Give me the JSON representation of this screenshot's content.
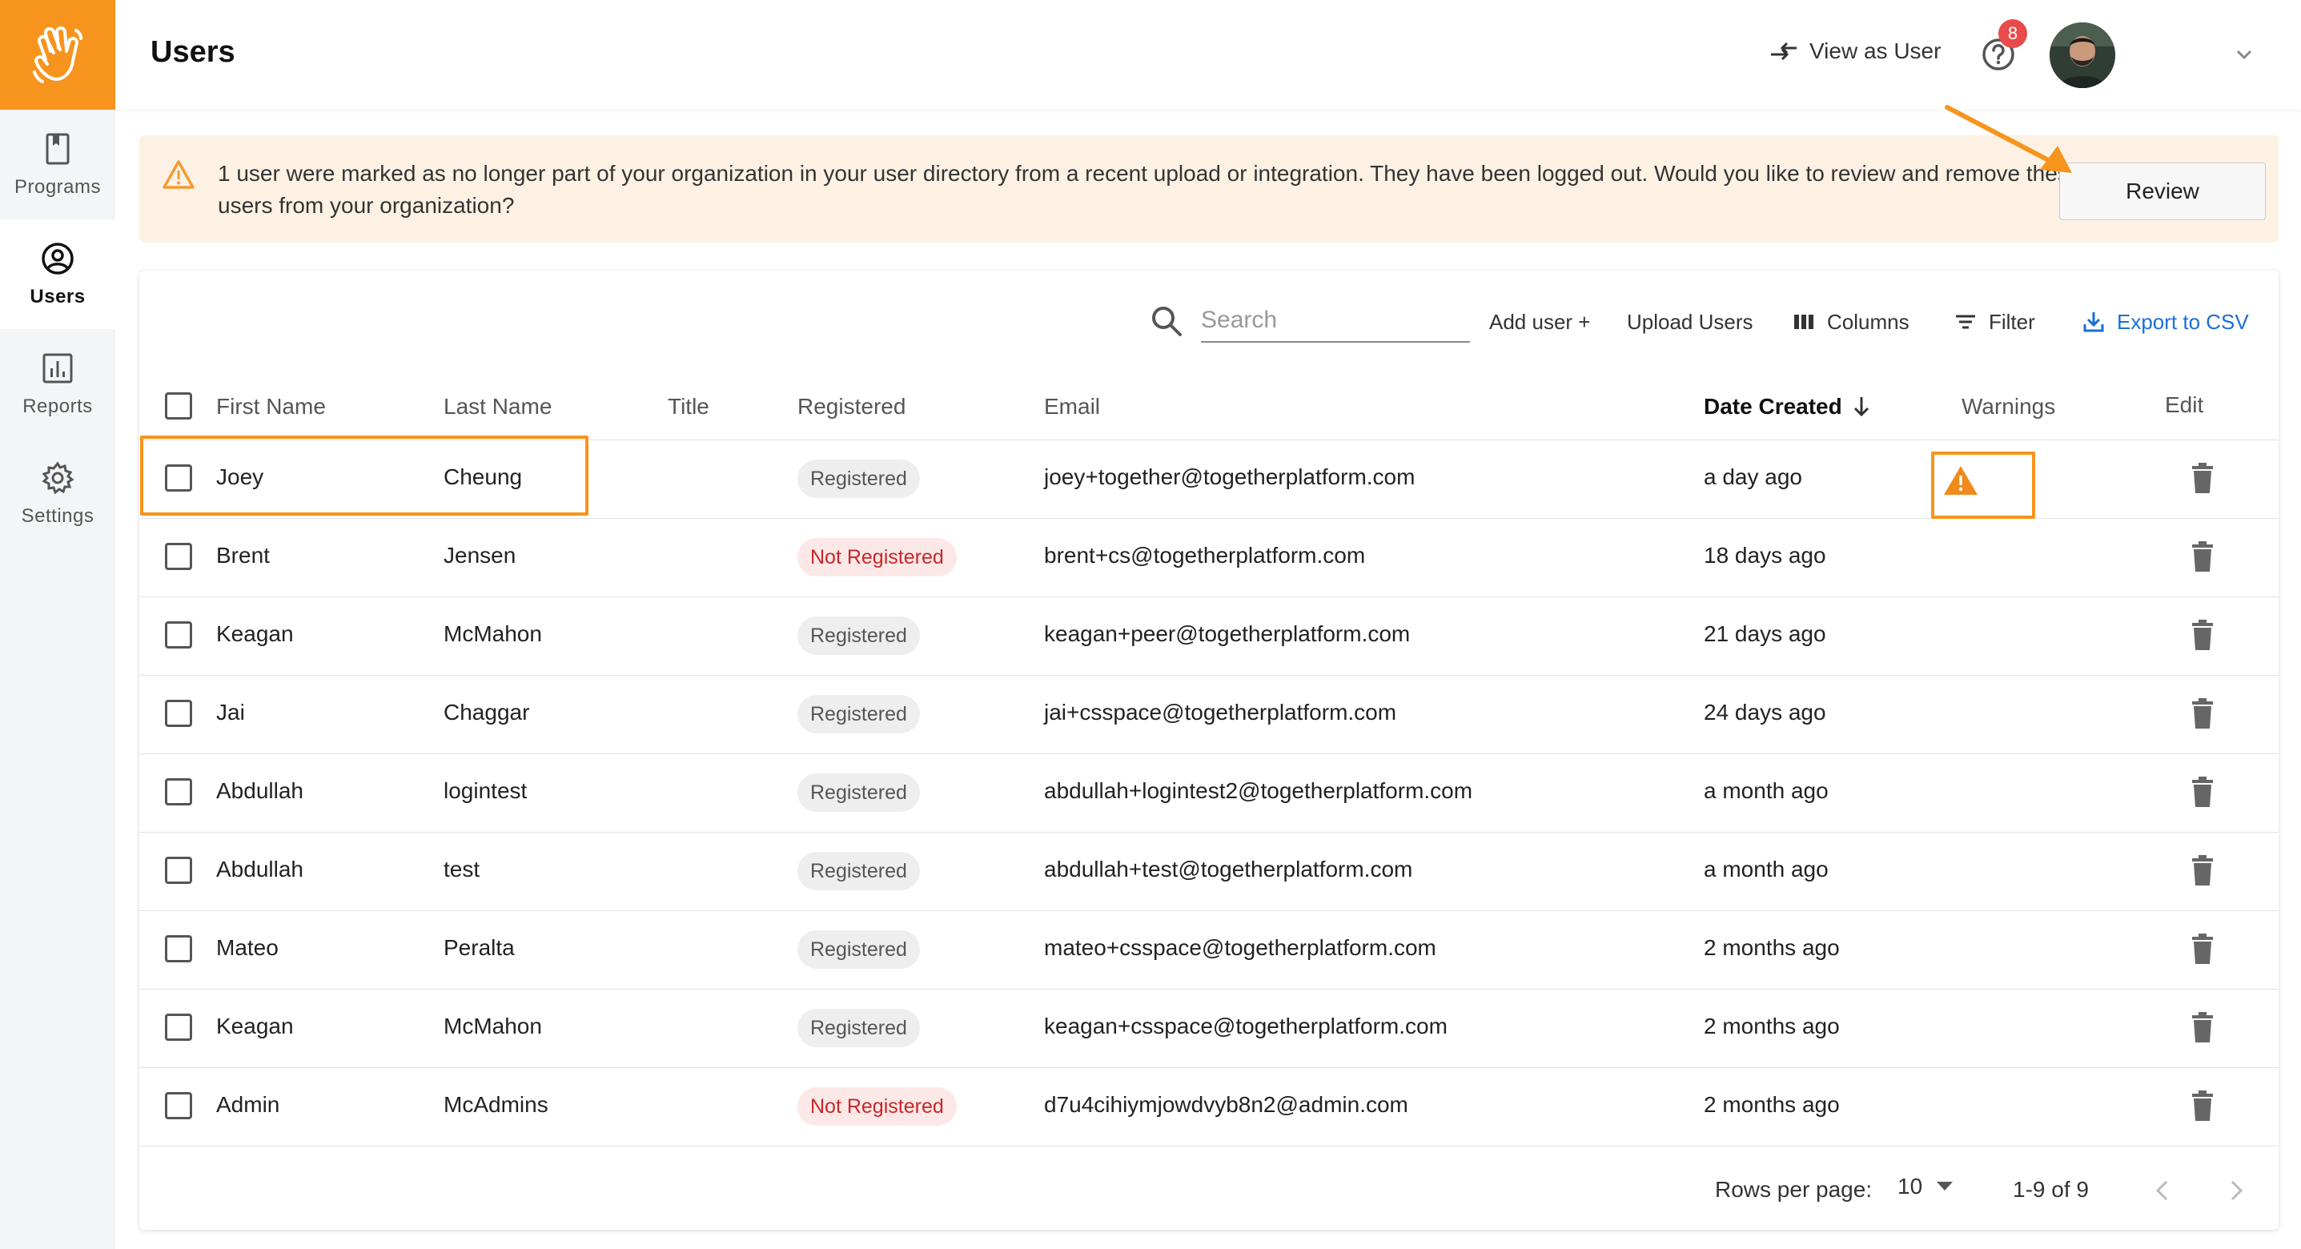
{
  "sidebar": {
    "logo_icon": "waving-hand-icon",
    "items": [
      {
        "label": "Programs",
        "icon": "book-icon",
        "active": false
      },
      {
        "label": "Users",
        "icon": "user-circle-icon",
        "active": true
      },
      {
        "label": "Reports",
        "icon": "bar-chart-icon",
        "active": false
      },
      {
        "label": "Settings",
        "icon": "gear-icon",
        "active": false
      }
    ]
  },
  "header": {
    "title": "Users",
    "view_as_user": "View as User",
    "help_badge_count": "8"
  },
  "banner": {
    "message": "1 user were marked as no longer part of your organization in your user directory from a recent upload or integration. They have been logged out. Would you like to review and remove these users from your organization?",
    "review_label": "Review"
  },
  "toolbar": {
    "search_placeholder": "Search",
    "add_user": "Add user +",
    "upload_users": "Upload Users",
    "columns": "Columns",
    "filter": "Filter",
    "export_csv": "Export to CSV"
  },
  "table": {
    "columns": {
      "first_name": "First Name",
      "last_name": "Last Name",
      "title": "Title",
      "registered": "Registered",
      "email": "Email",
      "date_created": "Date Created",
      "warnings": "Warnings",
      "edit": "Edit"
    },
    "rows": [
      {
        "first": "Joey",
        "last": "Cheung",
        "title": "",
        "status": "Registered",
        "email": "joey+together@togetherplatform.com",
        "created": "a day ago",
        "warning": true
      },
      {
        "first": "Brent",
        "last": "Jensen",
        "title": "",
        "status": "Not Registered",
        "email": "brent+cs@togetherplatform.com",
        "created": "18 days ago",
        "warning": false
      },
      {
        "first": "Keagan",
        "last": "McMahon",
        "title": "",
        "status": "Registered",
        "email": "keagan+peer@togetherplatform.com",
        "created": "21 days ago",
        "warning": false
      },
      {
        "first": "Jai",
        "last": "Chaggar",
        "title": "",
        "status": "Registered",
        "email": "jai+csspace@togetherplatform.com",
        "created": "24 days ago",
        "warning": false
      },
      {
        "first": "Abdullah",
        "last": "logintest",
        "title": "",
        "status": "Registered",
        "email": "abdullah+logintest2@togetherplatform.com",
        "created": "a month ago",
        "warning": false
      },
      {
        "first": "Abdullah",
        "last": "test",
        "title": "",
        "status": "Registered",
        "email": "abdullah+test@togetherplatform.com",
        "created": "a month ago",
        "warning": false
      },
      {
        "first": "Mateo",
        "last": "Peralta",
        "title": "",
        "status": "Registered",
        "email": "mateo+csspace@togetherplatform.com",
        "created": "2 months ago",
        "warning": false
      },
      {
        "first": "Keagan",
        "last": "McMahon",
        "title": "",
        "status": "Registered",
        "email": "keagan+csspace@togetherplatform.com",
        "created": "2 months ago",
        "warning": false
      },
      {
        "first": "Admin",
        "last": "McAdmins",
        "title": "",
        "status": "Not Registered",
        "email": "d7u4cihiymjowdvyb8n2@admin.com",
        "created": "2 months ago",
        "warning": false
      }
    ]
  },
  "pagination": {
    "rows_per_page_label": "Rows per page:",
    "rows_per_page": "10",
    "range": "1-9 of 9"
  },
  "colors": {
    "brand": "#f7941d",
    "link": "#1a6fd6",
    "danger": "#c62828",
    "banner_bg": "#fdf1e4"
  }
}
